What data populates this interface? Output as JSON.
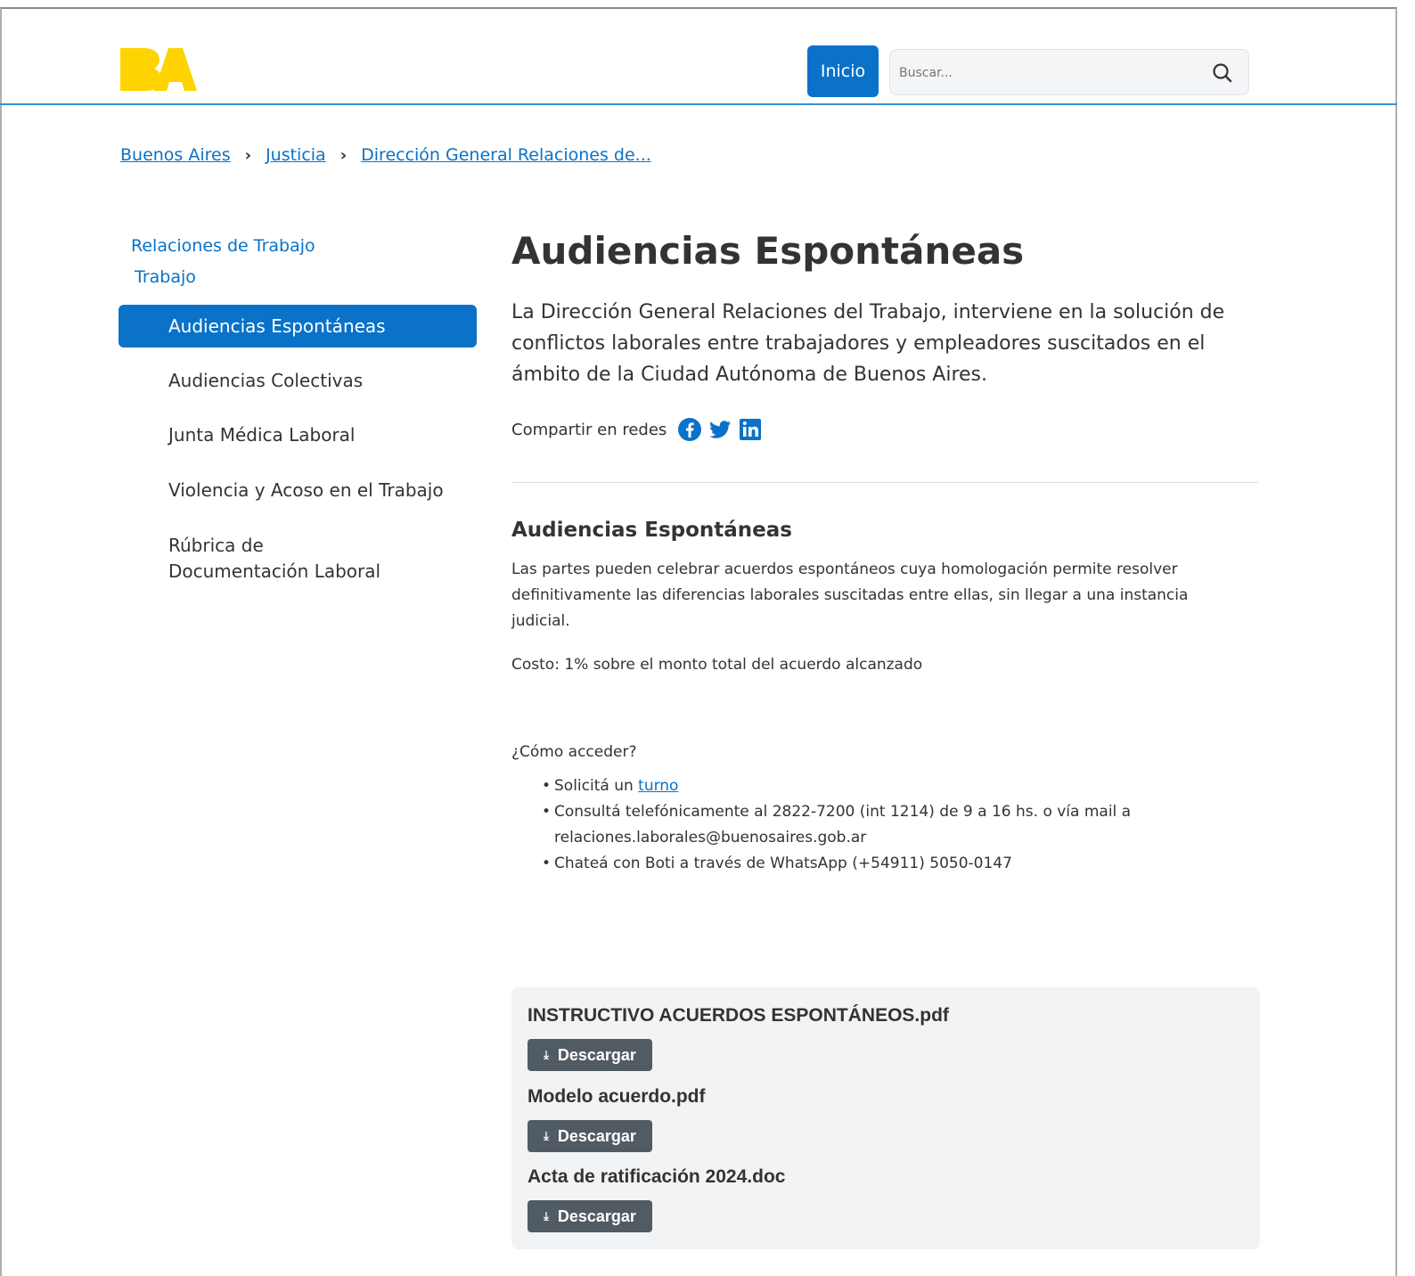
{
  "header": {
    "inicio_label": "Inicio",
    "search_placeholder": "Buscar..."
  },
  "breadcrumb": [
    "Buenos Aires",
    "Justicia",
    "Dirección General Relaciones de..."
  ],
  "sidebar": {
    "title_overlap": "Relaciones de Trabajo",
    "title_line2": "Trabajo",
    "items": [
      {
        "label": "Audiencias Espontáneas",
        "active": true
      },
      {
        "label": "Audiencias Colectivas"
      },
      {
        "label": "Junta Médica Laboral"
      },
      {
        "label": "Violencia y Acoso en el Trabajo"
      },
      {
        "label": "Rúbrica de Documentación Laboral"
      }
    ]
  },
  "main": {
    "title": "Audiencias Espontáneas",
    "lead": "La Dirección General Relaciones del Trabajo, interviene en la solución de conflictos laborales entre trabajadores y empleadores suscitados en el ámbito de la Ciudad Autónoma de Buenos Aires.",
    "share_label": "Compartir en redes",
    "section_title": "Audiencias Espontáneas",
    "paragraph": "Las partes pueden celebrar acuerdos espontáneos cuya homologación permite resolver definitivamente las diferencias laborales suscitadas entre ellas, sin llegar a una instancia judicial.",
    "cost": "Costo: 1% sobre el monto total del acuerdo alcanzado",
    "how_title": "¿Cómo acceder?",
    "list": {
      "item1_prefix": "Solicitá un",
      "item1_link": "turno",
      "item2_line1": "Consultá telefónicamente al 2822-7200 (int 1214) de 9 a 16 hs. o vía mail a",
      "item2_line2": "relaciones.laborales@buenosaires.gob.ar",
      "item3": "Chateá con Boti a través de WhatsApp (+54911) 5050-0147"
    }
  },
  "downloads": {
    "button_label": "Descargar",
    "files": [
      "INSTRUCTIVO ACUERDOS ESPONTÁNEOS.pdf",
      "Modelo acuerdo.pdf",
      "Acta de ratificación 2024.doc"
    ]
  },
  "colors": {
    "primary": "#0a72c8",
    "logo_yellow": "#ffd300",
    "download_button": "#515b64",
    "download_panel": "#f1f3f5"
  }
}
